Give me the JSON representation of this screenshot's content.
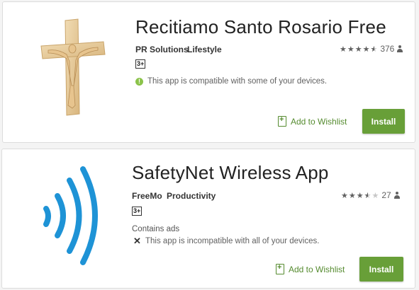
{
  "apps": [
    {
      "title": "Recitiamo Santo Rosario Free",
      "developer": "PR Solutions",
      "category": "Lifestyle",
      "rating_count": "376",
      "rating_stars": 4.5,
      "content_rating": "3+",
      "compatibility": "This app is compatible with some of your devices.",
      "compatibility_icon": "info-icon",
      "wishlist_label": "Add to Wishlist",
      "install_label": "Install",
      "icon": "crucifix-icon"
    },
    {
      "title": "SafetyNet Wireless App",
      "developer": "FreeMo",
      "category": "Productivity",
      "rating_count": "27",
      "rating_stars": 3.5,
      "content_rating": "3+",
      "contains_ads": "Contains ads",
      "compatibility": "This app is incompatible with all of your devices.",
      "compatibility_icon": "close-icon",
      "wishlist_label": "Add to Wishlist",
      "install_label": "Install",
      "icon": "wireless-signal-icon"
    }
  ],
  "colors": {
    "accent_green": "#689f38",
    "wishlist_green": "#558b2f",
    "signal_blue": "#1e93d6",
    "crucifix_wood": "#e8cfa3"
  }
}
